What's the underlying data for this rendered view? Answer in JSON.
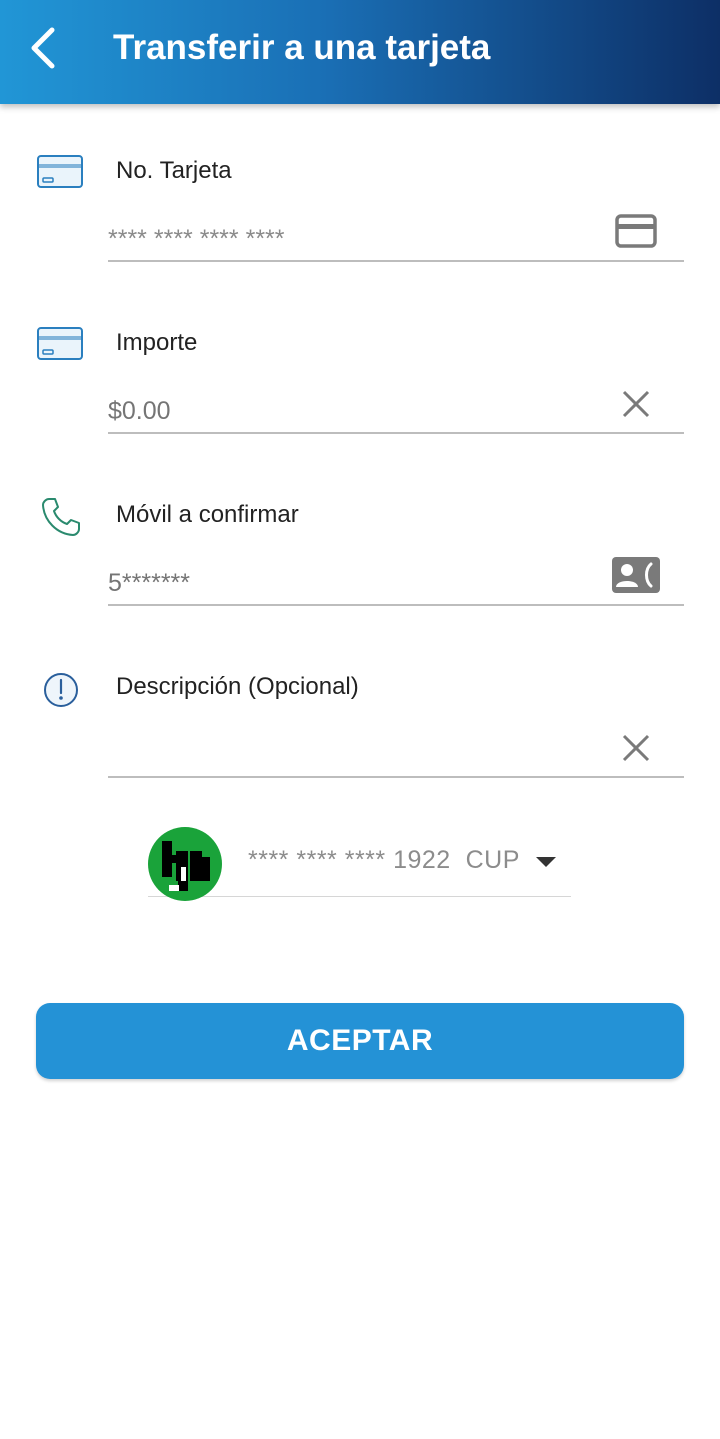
{
  "appbar": {
    "title": "Transferir a una tarjeta",
    "back_icon": "chevron-left-icon",
    "gradient": [
      "#2196d6",
      "#0d2f66"
    ]
  },
  "form": {
    "card_number": {
      "label": "No. Tarjeta",
      "placeholder": "**** **** **** ****",
      "value": "",
      "icon": "credit-card-icon",
      "trailing_icon": "card-icon"
    },
    "amount": {
      "label": "Importe",
      "value": "$0.00",
      "icon": "credit-card-icon",
      "trailing_icon": "close-icon"
    },
    "mobile": {
      "label": "Móvil a confirmar",
      "value": "5*******",
      "icon": "phone-icon",
      "trailing_icon": "contact-card-icon"
    },
    "description": {
      "label": "Descripción (Opcional)",
      "value": "",
      "icon": "info-icon",
      "trailing_icon": "close-icon"
    }
  },
  "account": {
    "masked": "**** **** **** 1922",
    "currency": "CUP",
    "selected": "**** **** **** 1922  CUP"
  },
  "accept_button": {
    "label": "ACEPTAR",
    "color": "#2492d6"
  }
}
